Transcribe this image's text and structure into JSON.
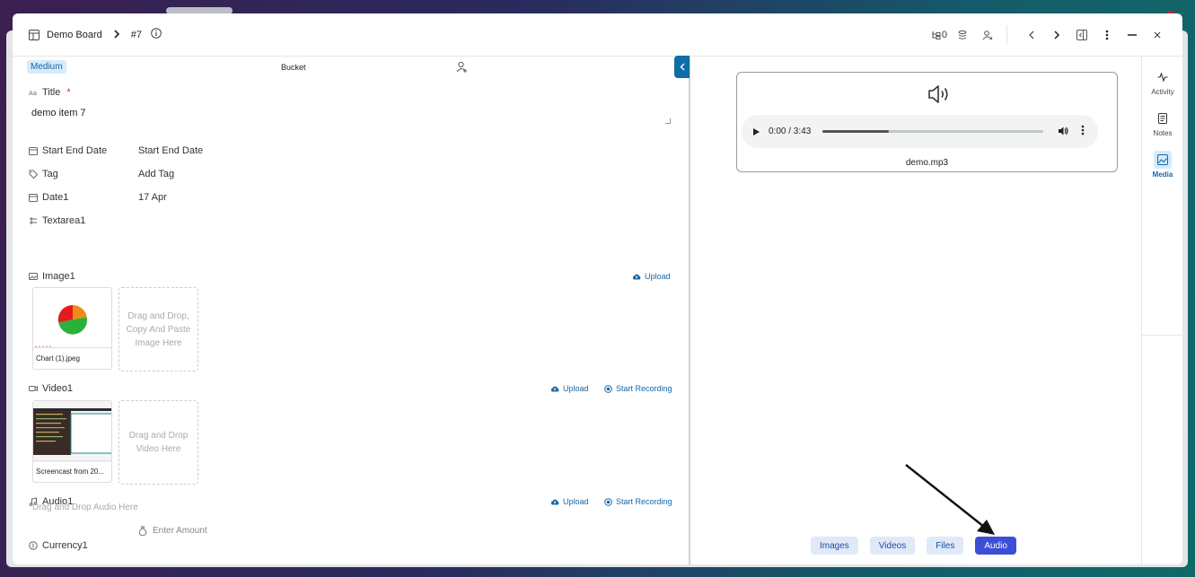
{
  "header": {
    "board_name": "Demo Board",
    "separator": ">",
    "item_number": "#7",
    "subtask_count": "0"
  },
  "left": {
    "priority": "Medium",
    "bucket": "Bucket",
    "title_label": "Title",
    "title_required": "*",
    "title_value": "demo item 7",
    "fields": {
      "start_end_label": "Start End Date",
      "start_end_value": "Start End Date",
      "tag_label": "Tag",
      "tag_value": "Add Tag",
      "date1_label": "Date1",
      "date1_value": "17 Apr",
      "textarea1_label": "Textarea1"
    },
    "image": {
      "label": "Image1",
      "upload": "Upload",
      "file_name": "Chart (1).jpeg",
      "drop_text": "Drag and Drop, Copy And Paste Image Here"
    },
    "video": {
      "label": "Video1",
      "upload": "Upload",
      "record": "Start Recording",
      "file_name": "Screencast from 20...",
      "drop_text": "Drag and Drop Video Here"
    },
    "audio": {
      "label": "Audio1",
      "upload": "Upload",
      "record": "Start Recording",
      "drop_text": "Drag and Drop Audio Here"
    },
    "currency": {
      "label": "Currency1",
      "placeholder": "Enter Amount"
    }
  },
  "media": {
    "player_time": "0:00 / 3:43",
    "progress": 0.3,
    "file_name": "demo.mp3",
    "tabs": [
      {
        "label": "Images",
        "active": false
      },
      {
        "label": "Videos",
        "active": false
      },
      {
        "label": "Files",
        "active": false
      },
      {
        "label": "Audio",
        "active": true
      }
    ]
  },
  "rail": {
    "activity": "Activity",
    "notes": "Notes",
    "media": "Media"
  },
  "colors": {
    "accent": "#1567a8",
    "active_tab": "#3d4ed6",
    "badge_bg": "#d6ebfb"
  }
}
